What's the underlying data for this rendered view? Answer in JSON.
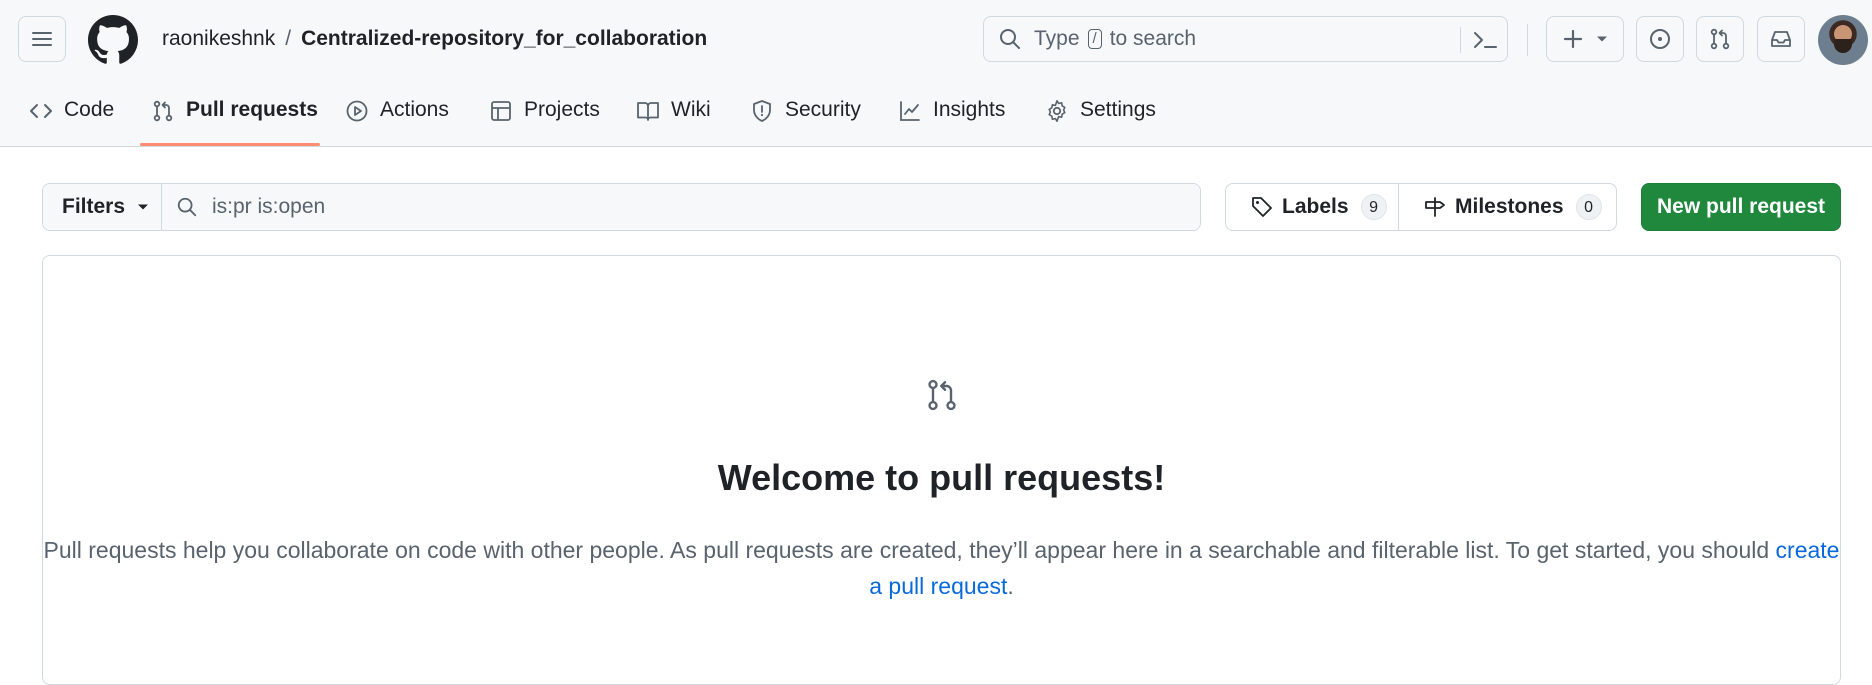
{
  "header": {
    "owner": "raonikeshnk",
    "separator": "/",
    "repo": "Centralized-repository_for_collaboration",
    "search": {
      "placeholder_before": "Type",
      "shortcut_key": "/",
      "placeholder_after": "to search"
    },
    "icons": [
      "hamburger-icon",
      "github-logo",
      "search-icon",
      "command-palette-icon",
      "plus-icon",
      "issues-icon",
      "pull-requests-icon",
      "inbox-icon"
    ]
  },
  "repo_nav": {
    "tabs": [
      {
        "label": "Code",
        "icon": "code-icon"
      },
      {
        "label": "Pull requests",
        "icon": "git-pull-request-icon",
        "active": true
      },
      {
        "label": "Actions",
        "icon": "play-icon"
      },
      {
        "label": "Projects",
        "icon": "table-icon"
      },
      {
        "label": "Wiki",
        "icon": "book-icon"
      },
      {
        "label": "Security",
        "icon": "shield-icon"
      },
      {
        "label": "Insights",
        "icon": "graph-icon"
      },
      {
        "label": "Settings",
        "icon": "gear-icon"
      }
    ]
  },
  "subnav": {
    "filters_label": "Filters",
    "query": "is:pr is:open",
    "labels_label": "Labels",
    "labels_count": "9",
    "milestones_label": "Milestones",
    "milestones_count": "0",
    "new_pr_label": "New pull request"
  },
  "blankslate": {
    "title": "Welcome to pull requests!",
    "text_before_link": "Pull requests help you collaborate on code with other people. As pull requests are created, they’ll appear here in a searchable and filterable list. To get started, you should",
    "link_text": "create a pull request",
    "text_after_link": "."
  },
  "colors": {
    "accent_green": "#1f883d",
    "active_tab_underline": "#fd8c73",
    "link_blue": "#0969da",
    "header_bg": "#f6f8fa"
  }
}
